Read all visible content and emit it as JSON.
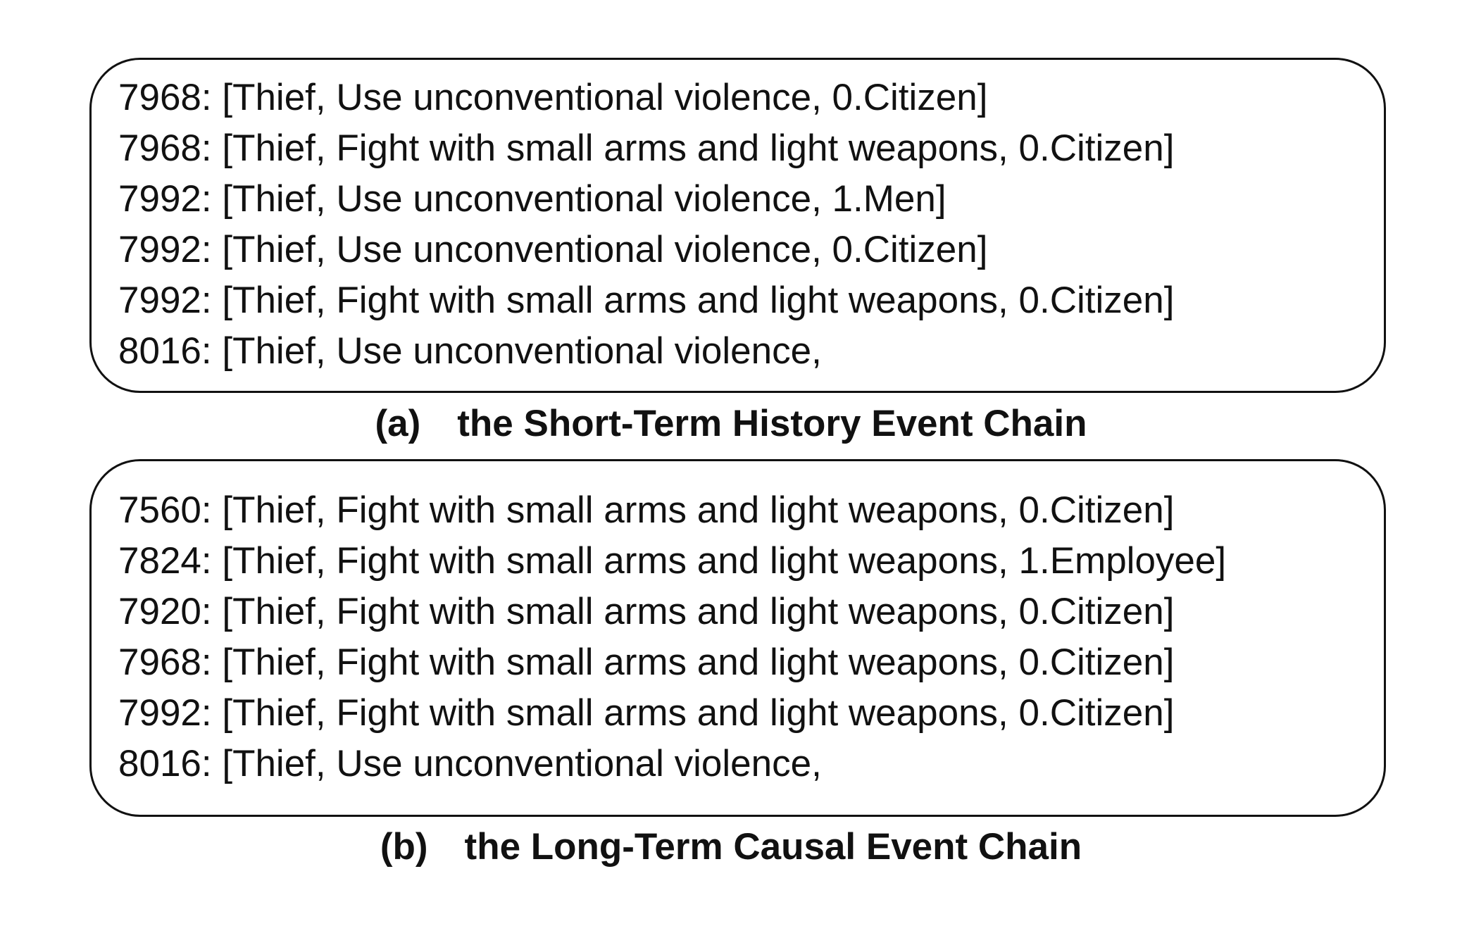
{
  "panel_a": {
    "lines": [
      "7968: [Thief, Use unconventional violence, 0.Citizen]",
      "7968: [Thief, Fight with small arms and light weapons, 0.Citizen]",
      "7992: [Thief, Use unconventional violence, 1.Men]",
      "7992: [Thief, Use unconventional violence, 0.Citizen]",
      "7992: [Thief, Fight with small arms and light weapons, 0.Citizen]",
      "8016: [Thief, Use unconventional violence,"
    ],
    "caption_tag": "(a)",
    "caption_text": "the Short-Term History Event Chain"
  },
  "panel_b": {
    "lines": [
      "7560: [Thief, Fight with small arms and light weapons, 0.Citizen]",
      "7824: [Thief, Fight with small arms and light weapons, 1.Employee]",
      "7920: [Thief, Fight with small arms and light weapons, 0.Citizen]",
      "7968: [Thief, Fight with small arms and light weapons, 0.Citizen]",
      "7992: [Thief, Fight with small arms and light weapons, 0.Citizen]",
      "8016: [Thief, Use unconventional violence,"
    ],
    "caption_tag": "(b)",
    "caption_text": "the Long-Term Causal Event Chain"
  }
}
